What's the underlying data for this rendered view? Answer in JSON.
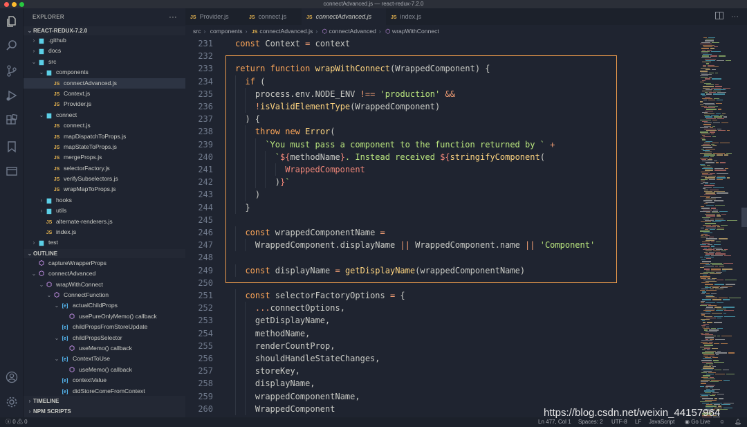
{
  "window": {
    "title": "connectAdvanced.js — react-redux-7.2.0"
  },
  "colors": {
    "accent": "#ffcc66",
    "highlight_box": "#f29e4c",
    "background": "#1f2430"
  },
  "activity_bar": {
    "icons": [
      "explorer-icon",
      "search-icon",
      "source-control-icon",
      "run-debug-icon",
      "extensions-icon",
      "bookmarks-icon",
      "remote-explorer-icon",
      "account-icon",
      "settings-icon"
    ]
  },
  "sidebar": {
    "header": "EXPLORER",
    "header_menu": "···",
    "project_section": "REACT-REDUX-7.2.0",
    "tree": [
      {
        "label": ".github",
        "kind": "folder-collapsed",
        "depth": 0
      },
      {
        "label": "docs",
        "kind": "folder-collapsed",
        "depth": 0
      },
      {
        "label": "src",
        "kind": "folder-open",
        "depth": 0
      },
      {
        "label": "components",
        "kind": "folder-open",
        "depth": 1
      },
      {
        "label": "connectAdvanced.js",
        "kind": "js",
        "depth": 2,
        "active": true
      },
      {
        "label": "Context.js",
        "kind": "js",
        "depth": 2
      },
      {
        "label": "Provider.js",
        "kind": "js",
        "depth": 2
      },
      {
        "label": "connect",
        "kind": "folder-open",
        "depth": 1
      },
      {
        "label": "connect.js",
        "kind": "js",
        "depth": 2
      },
      {
        "label": "mapDispatchToProps.js",
        "kind": "js",
        "depth": 2
      },
      {
        "label": "mapStateToProps.js",
        "kind": "js",
        "depth": 2
      },
      {
        "label": "mergeProps.js",
        "kind": "js",
        "depth": 2
      },
      {
        "label": "selectorFactory.js",
        "kind": "js",
        "depth": 2
      },
      {
        "label": "verifySubselectors.js",
        "kind": "js",
        "depth": 2
      },
      {
        "label": "wrapMapToProps.js",
        "kind": "js",
        "depth": 2
      },
      {
        "label": "hooks",
        "kind": "folder-collapsed",
        "depth": 1
      },
      {
        "label": "utils",
        "kind": "folder-collapsed",
        "depth": 1
      },
      {
        "label": "alternate-renderers.js",
        "kind": "js",
        "depth": 1
      },
      {
        "label": "index.js",
        "kind": "js",
        "depth": 1
      },
      {
        "label": "test",
        "kind": "folder-collapsed",
        "depth": 0
      }
    ],
    "outline_section": "OUTLINE",
    "outline": [
      {
        "label": "captureWrapperProps",
        "kind": "sym",
        "depth": 0,
        "chev": ""
      },
      {
        "label": "connectAdvanced",
        "kind": "sym",
        "depth": 0,
        "chev": "open"
      },
      {
        "label": "wrapWithConnect",
        "kind": "sym",
        "depth": 1,
        "chev": "open"
      },
      {
        "label": "ConnectFunction",
        "kind": "sym",
        "depth": 2,
        "chev": "open"
      },
      {
        "label": "actualChildProps",
        "kind": "var",
        "depth": 3,
        "chev": "open"
      },
      {
        "label": "usePureOnlyMemo() callback",
        "kind": "sym",
        "depth": 4,
        "chev": ""
      },
      {
        "label": "childPropsFromStoreUpdate",
        "kind": "var",
        "depth": 3,
        "chev": ""
      },
      {
        "label": "childPropsSelector",
        "kind": "var",
        "depth": 3,
        "chev": "open"
      },
      {
        "label": "useMemo() callback",
        "kind": "sym",
        "depth": 4,
        "chev": ""
      },
      {
        "label": "ContextToUse",
        "kind": "var",
        "depth": 3,
        "chev": "open"
      },
      {
        "label": "useMemo() callback",
        "kind": "sym",
        "depth": 4,
        "chev": ""
      },
      {
        "label": "contextValue",
        "kind": "var",
        "depth": 3,
        "chev": ""
      },
      {
        "label": "didStoreComeFromContext",
        "kind": "var",
        "depth": 3,
        "chev": ""
      }
    ],
    "timeline_section": "TIMELINE",
    "npm_section": "NPM SCRIPTS"
  },
  "tabs": [
    {
      "label": "Provider.js",
      "active": false
    },
    {
      "label": "connect.js",
      "active": false
    },
    {
      "label": "connectAdvanced.js",
      "active": true
    },
    {
      "label": "index.js",
      "active": false
    }
  ],
  "tab_badge": "JS",
  "tab_menu": "···",
  "breadcrumb": [
    "src",
    "components",
    "connectAdvanced.js",
    "connectAdvanced",
    "wrapWithConnect"
  ],
  "editor": {
    "lines": [
      {
        "num": "231",
        "indent": 1,
        "tokens": [
          [
            "k",
            "const "
          ],
          [
            "n",
            "Context "
          ],
          [
            "o",
            "= "
          ],
          [
            "n",
            "context"
          ]
        ]
      },
      {
        "num": "232",
        "indent": 0,
        "tokens": []
      },
      {
        "num": "233",
        "indent": 1,
        "tokens": [
          [
            "k",
            "return "
          ],
          [
            "k",
            "function "
          ],
          [
            "f",
            "wrapWithConnect"
          ],
          [
            "n",
            "("
          ],
          [
            "n",
            "WrappedComponent"
          ],
          [
            "n",
            ") {"
          ]
        ]
      },
      {
        "num": "234",
        "indent": 2,
        "tokens": [
          [
            "k",
            "if "
          ],
          [
            "n",
            "("
          ]
        ]
      },
      {
        "num": "235",
        "indent": 3,
        "tokens": [
          [
            "n",
            "process"
          ],
          [
            "n",
            "."
          ],
          [
            "n",
            "env"
          ],
          [
            "n",
            "."
          ],
          [
            "n",
            "NODE_ENV "
          ],
          [
            "o",
            "!== "
          ],
          [
            "s",
            "'production' "
          ],
          [
            "o",
            "&&"
          ]
        ]
      },
      {
        "num": "236",
        "indent": 3,
        "tokens": [
          [
            "o",
            "!"
          ],
          [
            "f",
            "isValidElementType"
          ],
          [
            "n",
            "("
          ],
          [
            "n",
            "WrappedComponent"
          ],
          [
            "n",
            ")"
          ]
        ]
      },
      {
        "num": "237",
        "indent": 2,
        "tokens": [
          [
            "n",
            ") {"
          ]
        ]
      },
      {
        "num": "238",
        "indent": 3,
        "tokens": [
          [
            "k",
            "throw "
          ],
          [
            "k",
            "new "
          ],
          [
            "f",
            "Error"
          ],
          [
            "n",
            "("
          ]
        ]
      },
      {
        "num": "239",
        "indent": 4,
        "tokens": [
          [
            "s",
            "`You must pass a component to the function returned by ` "
          ],
          [
            "o",
            "+"
          ]
        ]
      },
      {
        "num": "240",
        "indent": 5,
        "tokens": [
          [
            "s",
            "`"
          ],
          [
            "p",
            "${"
          ],
          [
            "n",
            "methodName"
          ],
          [
            "p",
            "}"
          ],
          [
            "s",
            ". Instead received "
          ],
          [
            "p",
            "${"
          ],
          [
            "f",
            "stringifyComponent"
          ],
          [
            "n",
            "("
          ]
        ]
      },
      {
        "num": "241",
        "indent": 6,
        "tokens": [
          [
            "p",
            "WrappedComponent"
          ]
        ]
      },
      {
        "num": "242",
        "indent": 5,
        "tokens": [
          [
            "n",
            ")"
          ],
          [
            "p",
            "}"
          ],
          [
            "s",
            "`"
          ]
        ]
      },
      {
        "num": "243",
        "indent": 3,
        "tokens": [
          [
            "n",
            ")"
          ]
        ]
      },
      {
        "num": "244",
        "indent": 2,
        "tokens": [
          [
            "n",
            "}"
          ]
        ]
      },
      {
        "num": "245",
        "indent": 0,
        "tokens": []
      },
      {
        "num": "246",
        "indent": 2,
        "tokens": [
          [
            "k",
            "const "
          ],
          [
            "n",
            "wrappedComponentName "
          ],
          [
            "o",
            "="
          ]
        ]
      },
      {
        "num": "247",
        "indent": 3,
        "tokens": [
          [
            "n",
            "WrappedComponent"
          ],
          [
            "n",
            "."
          ],
          [
            "n",
            "displayName "
          ],
          [
            "o",
            "|| "
          ],
          [
            "n",
            "WrappedComponent"
          ],
          [
            "n",
            "."
          ],
          [
            "n",
            "name "
          ],
          [
            "o",
            "|| "
          ],
          [
            "s",
            "'Component'"
          ]
        ]
      },
      {
        "num": "248",
        "indent": 0,
        "tokens": []
      },
      {
        "num": "249",
        "indent": 2,
        "tokens": [
          [
            "k",
            "const "
          ],
          [
            "n",
            "displayName "
          ],
          [
            "o",
            "= "
          ],
          [
            "f",
            "getDisplayName"
          ],
          [
            "n",
            "("
          ],
          [
            "n",
            "wrappedComponentName"
          ],
          [
            "n",
            ")"
          ]
        ]
      },
      {
        "num": "250",
        "indent": 0,
        "tokens": []
      },
      {
        "num": "251",
        "indent": 2,
        "tokens": [
          [
            "k",
            "const "
          ],
          [
            "n",
            "selectorFactoryOptions "
          ],
          [
            "o",
            "= "
          ],
          [
            "n",
            "{"
          ]
        ]
      },
      {
        "num": "252",
        "indent": 3,
        "tokens": [
          [
            "o",
            "..."
          ],
          [
            "n",
            "connectOptions"
          ],
          [
            "n",
            ","
          ]
        ]
      },
      {
        "num": "253",
        "indent": 3,
        "tokens": [
          [
            "n",
            "getDisplayName"
          ],
          [
            "n",
            ","
          ]
        ]
      },
      {
        "num": "254",
        "indent": 3,
        "tokens": [
          [
            "n",
            "methodName"
          ],
          [
            "n",
            ","
          ]
        ]
      },
      {
        "num": "255",
        "indent": 3,
        "tokens": [
          [
            "n",
            "renderCountProp"
          ],
          [
            "n",
            ","
          ]
        ]
      },
      {
        "num": "256",
        "indent": 3,
        "tokens": [
          [
            "n",
            "shouldHandleStateChanges"
          ],
          [
            "n",
            ","
          ]
        ]
      },
      {
        "num": "257",
        "indent": 3,
        "tokens": [
          [
            "n",
            "storeKey"
          ],
          [
            "n",
            ","
          ]
        ]
      },
      {
        "num": "258",
        "indent": 3,
        "tokens": [
          [
            "n",
            "displayName"
          ],
          [
            "n",
            ","
          ]
        ]
      },
      {
        "num": "259",
        "indent": 3,
        "tokens": [
          [
            "n",
            "wrappedComponentName"
          ],
          [
            "n",
            ","
          ]
        ]
      },
      {
        "num": "260",
        "indent": 3,
        "tokens": [
          [
            "n",
            "WrappedComponent"
          ]
        ]
      }
    ]
  },
  "statusbar": {
    "errors": "0",
    "warnings": "0",
    "position": "Ln 477, Col 1",
    "spaces": "Spaces: 2",
    "encoding": "UTF-8",
    "eol": "LF",
    "language": "JavaScript",
    "go_live": "Go Live"
  },
  "watermark": "https://blog.csdn.net/weixin_44157964"
}
